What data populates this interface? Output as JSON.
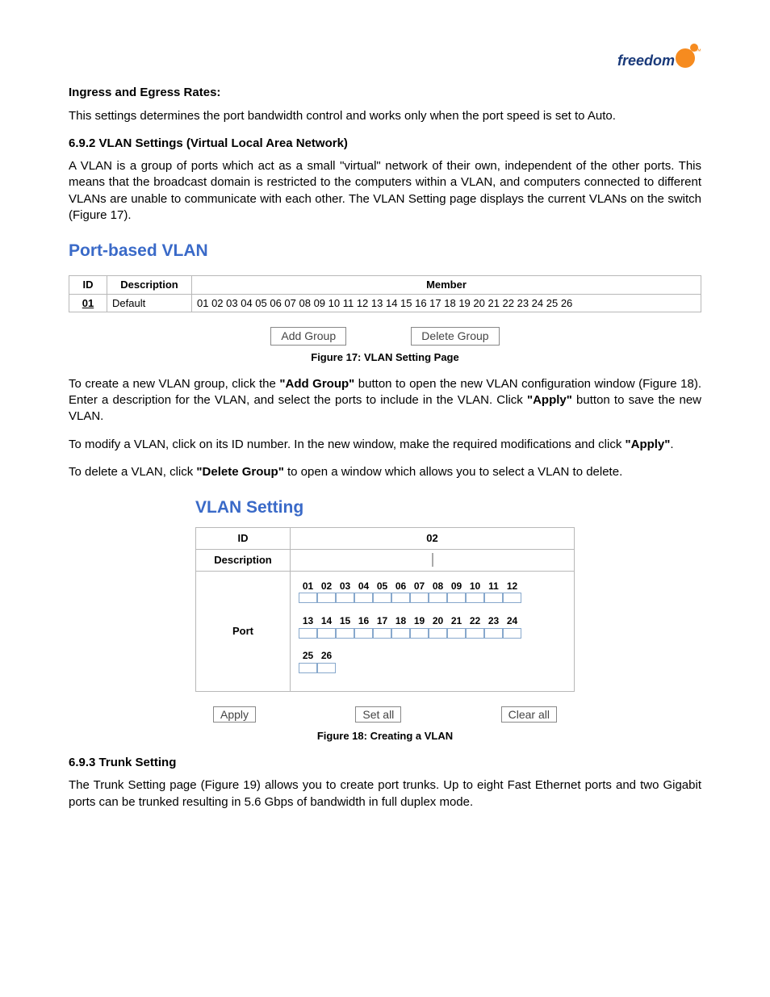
{
  "logo": {
    "text": "freedom",
    "tm": "™"
  },
  "section_ingress": {
    "heading": "Ingress and Egress Rates:",
    "body": "This settings determines the port bandwidth control and works only when the port speed is set to Auto."
  },
  "section_692": {
    "heading": "6.9.2   VLAN Settings (Virtual Local Area Network)",
    "body": "A VLAN is a group of ports which act as a small \"virtual\" network of their own, independent of the other ports. This means that the broadcast domain is restricted to the computers within a VLAN, and computers connected to different VLANs are unable to communicate with each other.   The VLAN Setting page displays the current VLANs on the switch (Figure 17)."
  },
  "fig17": {
    "title": "Port-based VLAN",
    "cols": {
      "id": "ID",
      "desc": "Description",
      "member": "Member"
    },
    "row": {
      "id": "01",
      "desc": "Default",
      "members": "01 02 03 04 05 06 07 08 09 10 11 12 13 14 15 16 17 18 19 20 21 22 23 24 25 26"
    },
    "buttons": {
      "add": "Add Group",
      "del": "Delete Group"
    },
    "caption": "Figure 17: VLAN Setting Page"
  },
  "para_create": {
    "pre": "To create a new VLAN group, click the ",
    "bold1": "\"Add Group\"",
    "mid": " button to open the new VLAN configuration window (Figure 18).  Enter a description for the VLAN, and select the ports to include in the VLAN.  Click ",
    "bold2": "\"Apply\"",
    "post": " button to save the new VLAN."
  },
  "para_modify": {
    "pre": "To modify a VLAN, click on its ID number.  In the new window, make the required modifications and click ",
    "bold": "\"Apply\"",
    "post": "."
  },
  "para_delete": {
    "pre": "To delete a VLAN, click ",
    "bold": "\"Delete Group\"",
    "post": " to open a window which allows you to select a VLAN to delete."
  },
  "fig18": {
    "title": "VLAN Setting",
    "labels": {
      "id": "ID",
      "desc": "Description",
      "port": "Port"
    },
    "id_value": "02",
    "ports_row1": [
      "01",
      "02",
      "03",
      "04",
      "05",
      "06",
      "07",
      "08",
      "09",
      "10",
      "11",
      "12"
    ],
    "ports_row2": [
      "13",
      "14",
      "15",
      "16",
      "17",
      "18",
      "19",
      "20",
      "21",
      "22",
      "23",
      "24"
    ],
    "ports_row3": [
      "25",
      "26"
    ],
    "buttons": {
      "apply": "Apply",
      "setall": "Set all",
      "clearall": "Clear all"
    },
    "caption": "Figure 18: Creating a VLAN"
  },
  "section_693": {
    "heading": "6.9.3   Trunk Setting",
    "body": "The Trunk Setting page (Figure 19) allows you to create port trunks.  Up to eight Fast Ethernet ports and two Gigabit ports can be trunked resulting in 5.6 Gbps of bandwidth in full duplex mode."
  }
}
